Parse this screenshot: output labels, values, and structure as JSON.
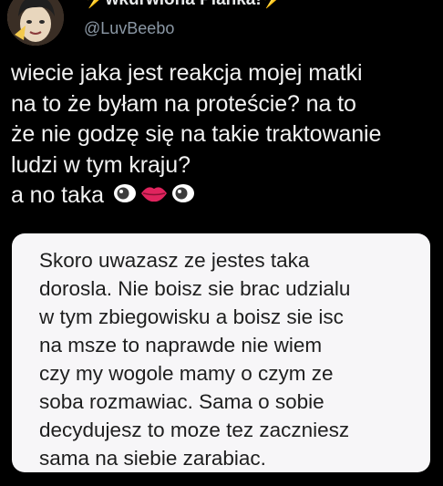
{
  "author": {
    "display_name": "⚡wkurwiona Pianka!⚡",
    "handle": "@LuvBeebo",
    "avatar": "avatar-image"
  },
  "tweet": {
    "lines": [
      "wiecie jaka jest reakcja mojej matki",
      "na to że byłam na proteście? na to",
      "że nie godzę się na takie traktowanie",
      "ludzi w tym kraju?",
      "a no taka"
    ],
    "emojis": [
      "eye-icon",
      "mouth-icon",
      "eye-icon"
    ]
  },
  "quoted_message": {
    "lines": [
      "Skoro uwazasz ze jestes taka",
      "dorosla. Nie boisz sie brac udzialu",
      "w tym zbiegowisku a boisz sie isc",
      "na msze to naprawde nie wiem",
      "czy my wogole mamy o czym ze",
      "soba rozmawiac. Sama o sobie",
      "decydujesz to moze tez zaczniesz",
      "sama na siebie zarabiac."
    ]
  },
  "colors": {
    "background": "#000000",
    "text": "#f2f2f2",
    "handle": "#8b98a5",
    "bubble": "#f7f6f8",
    "bubble_text": "#1e1e1e",
    "lips": "#e0245e"
  }
}
